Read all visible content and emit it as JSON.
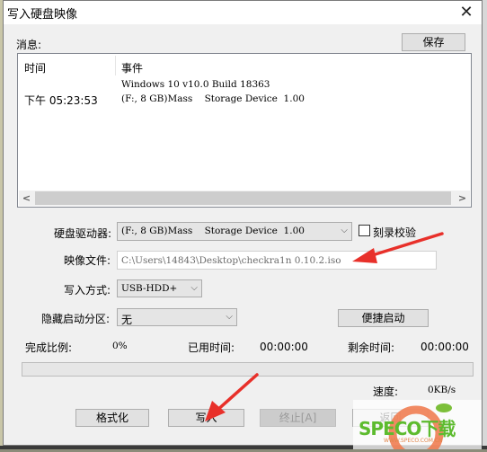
{
  "window": {
    "title": "写入硬盘映像",
    "close_icon": "close-icon"
  },
  "messages": {
    "label": "消息:",
    "save_button": "保存",
    "columns": [
      "时间",
      "事件"
    ],
    "rows": [
      {
        "time": "",
        "event": "Windows 10 v10.0 Build 18363"
      },
      {
        "time": "下午 05:23:53",
        "event": "(F:, 8 GB)Mass    Storage Device  1.00"
      }
    ]
  },
  "form": {
    "drive_label": "硬盘驱动器:",
    "drive_value": "(F:, 8 GB)Mass    Storage Device  1.00",
    "verify_label": "刻录校验",
    "verify_checked": false,
    "image_label": "映像文件:",
    "image_value": "C:\\Users\\14843\\Desktop\\checkra1n 0.10.2.iso",
    "write_mode_label": "写入方式:",
    "write_mode_value": "USB-HDD+",
    "hidden_partition_label": "隐藏启动分区:",
    "hidden_partition_value": "无",
    "quick_boot_button": "便捷启动"
  },
  "progress": {
    "complete_label": "完成比例:",
    "complete_value": "0%",
    "percent": 0,
    "elapsed_label": "已用时间:",
    "elapsed_value": "00:00:00",
    "remaining_label": "剩余时间:",
    "remaining_value": "00:00:00",
    "speed_label": "速度:",
    "speed_value": "0KB/s"
  },
  "buttons": {
    "format": "格式化",
    "write": "写入",
    "abort": "终止[A]",
    "back": "返回"
  },
  "annotations": {
    "arrow_color": "#e8302a"
  },
  "watermark": {
    "brand": "SPECO下载",
    "url": "WWW.SPECO.COM.CN"
  }
}
